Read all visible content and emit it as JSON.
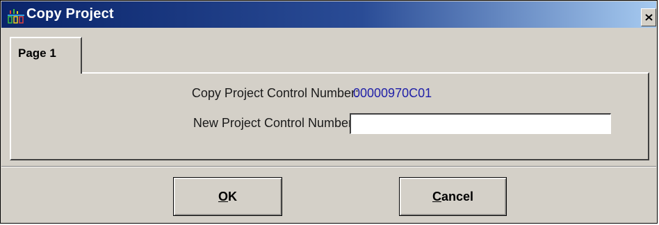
{
  "window": {
    "title": "Copy Project",
    "app_icon": "pcs-app-icon",
    "close_icon": "close-icon"
  },
  "tabs": [
    {
      "label": "Page 1",
      "active": true
    }
  ],
  "form": {
    "copy_label": "Copy Project Control Number:",
    "copy_value": "00000970C01",
    "new_label": "New Project Control Number:",
    "new_value": ""
  },
  "buttons": {
    "ok": {
      "mnemonic": "O",
      "rest": "K"
    },
    "cancel": {
      "mnemonic": "C",
      "rest": "ancel"
    }
  },
  "colors": {
    "title_bar_start": "#0a246a",
    "title_bar_end": "#a6caf0",
    "value_text": "#1f1fa8",
    "dialog_face": "#d4d0c8"
  }
}
